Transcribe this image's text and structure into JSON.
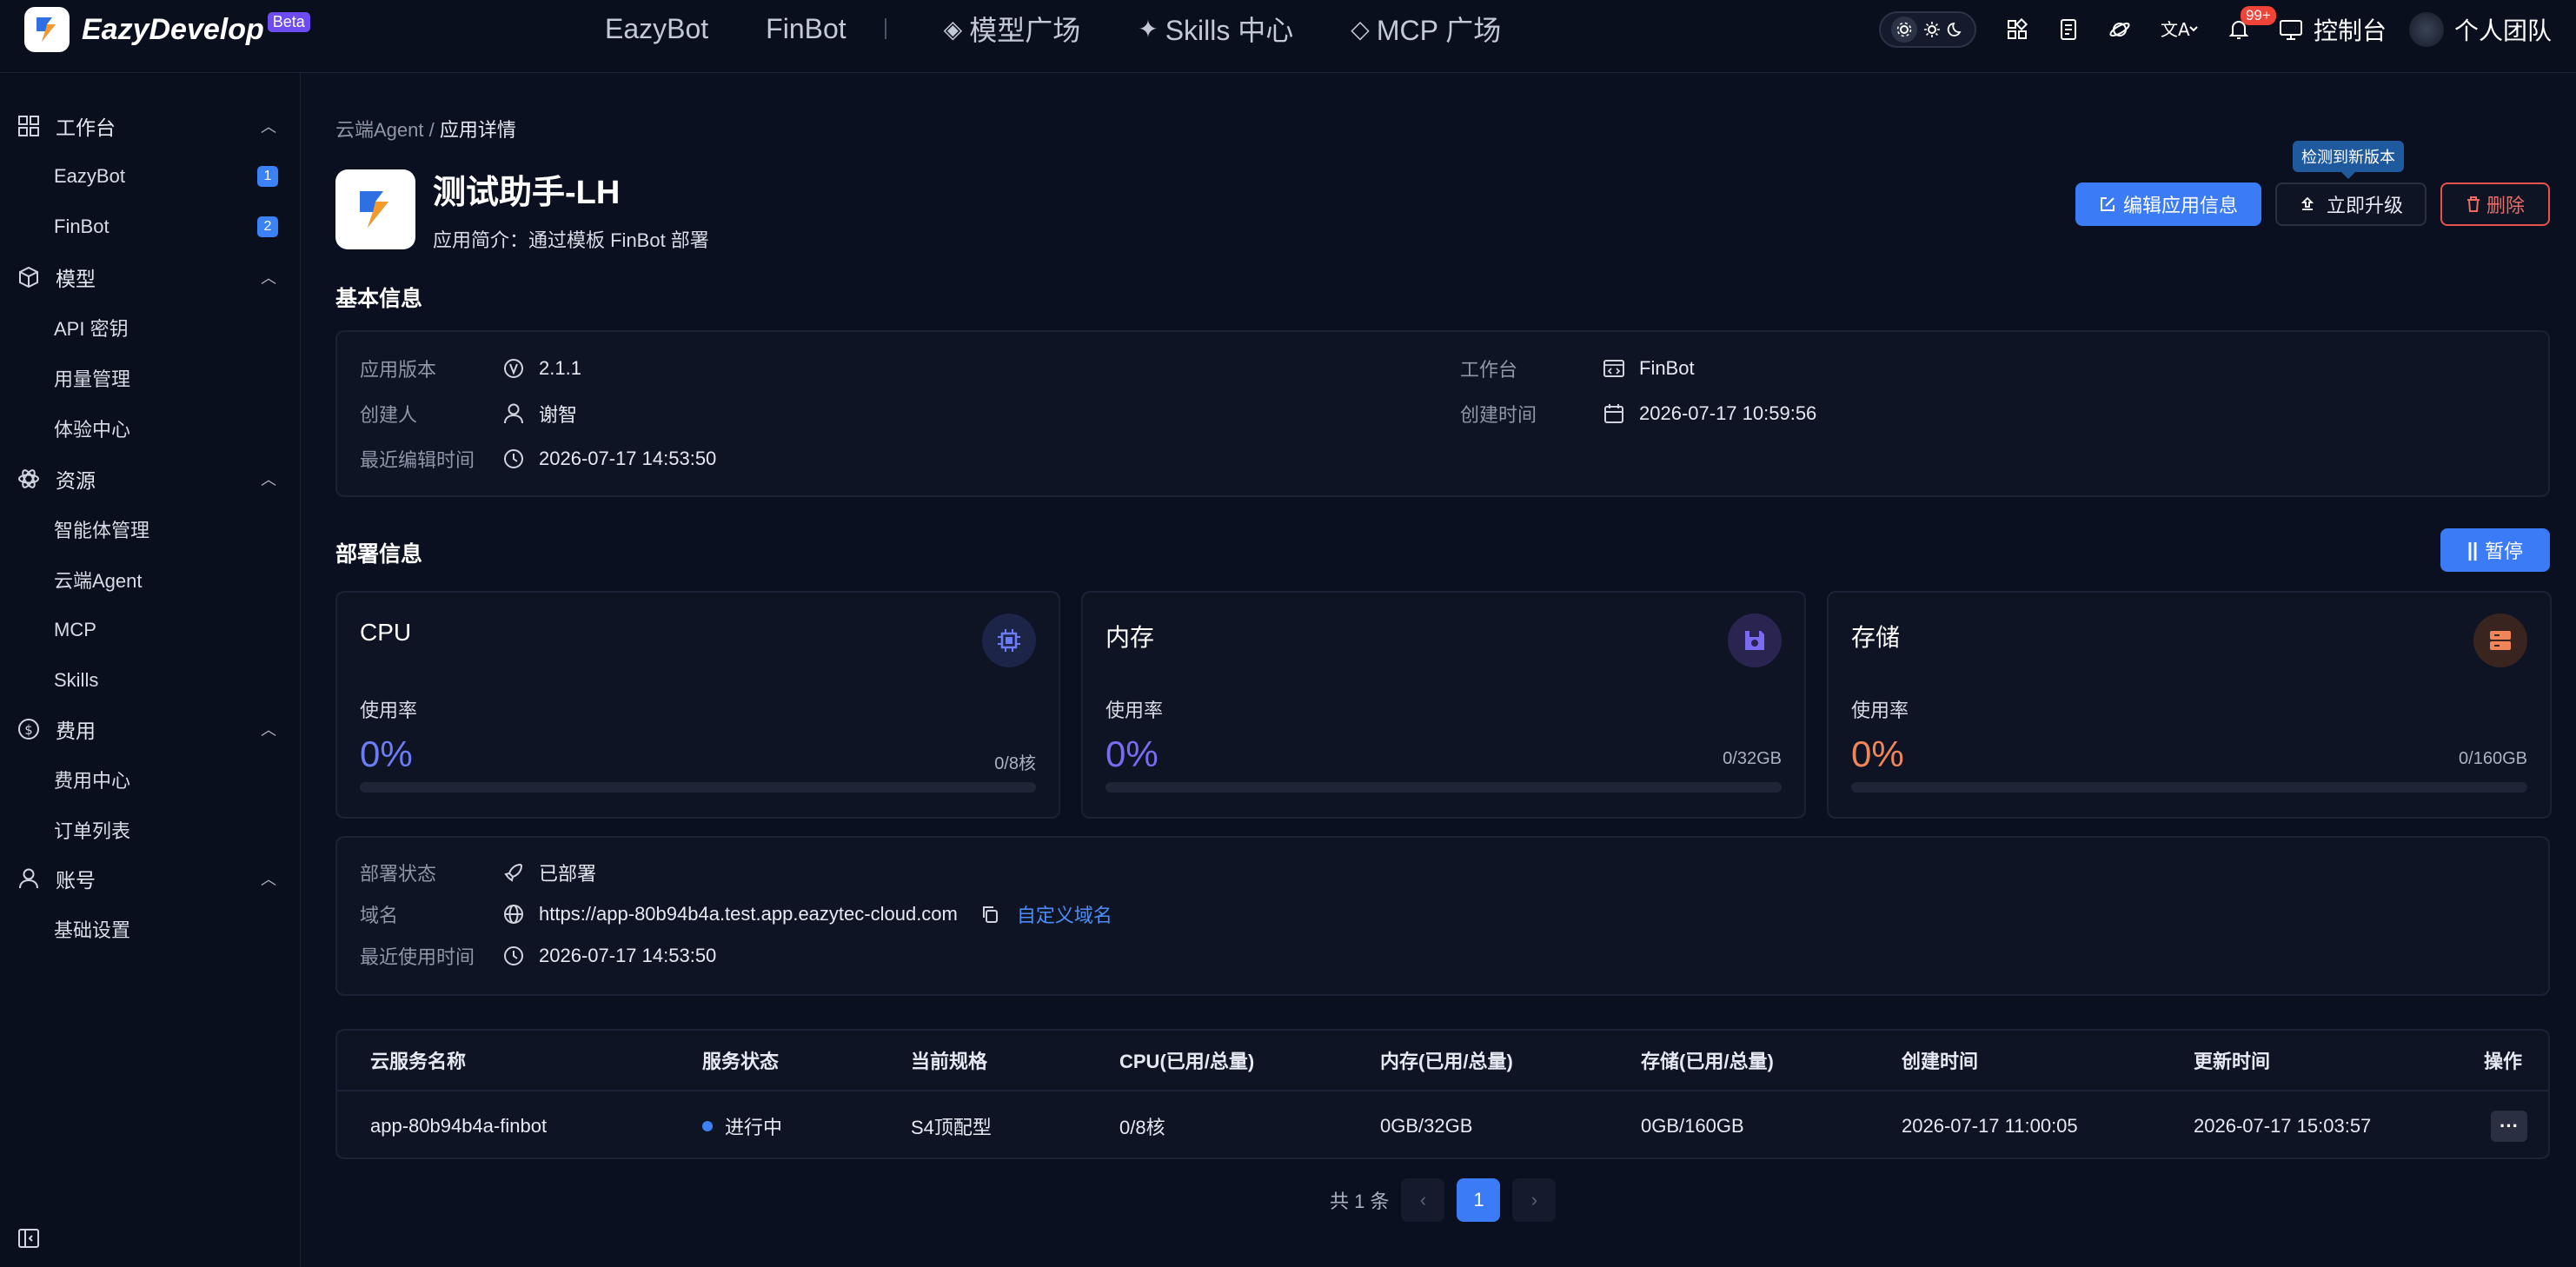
{
  "brand": {
    "name": "EazyDevelop",
    "badge": "Beta"
  },
  "topnav": {
    "items": [
      "EazyBot",
      "FinBot"
    ],
    "items2": [
      {
        "glyph": "◈",
        "label": "模型广场"
      },
      {
        "glyph": "✦",
        "label": "Skills 中心"
      },
      {
        "glyph": "◇",
        "label": "MCP 广场"
      }
    ]
  },
  "tools": {
    "notifications": "99+",
    "console": "控制台",
    "team": "个人团队"
  },
  "sidebar": {
    "groups": [
      {
        "label": "工作台",
        "icon": "grid-icon",
        "items": [
          {
            "label": "EazyBot",
            "count": "1"
          },
          {
            "label": "FinBot",
            "count": "2"
          }
        ]
      },
      {
        "label": "模型",
        "icon": "cube-icon",
        "items": [
          {
            "label": "API 密钥"
          },
          {
            "label": "用量管理"
          },
          {
            "label": "体验中心"
          }
        ]
      },
      {
        "label": "资源",
        "icon": "atom-icon",
        "items": [
          {
            "label": "智能体管理"
          },
          {
            "label": "云端Agent"
          },
          {
            "label": "MCP"
          },
          {
            "label": "Skills"
          }
        ]
      },
      {
        "label": "费用",
        "icon": "dollar-icon",
        "items": [
          {
            "label": "费用中心"
          },
          {
            "label": "订单列表"
          }
        ]
      },
      {
        "label": "账号",
        "icon": "user-icon",
        "items": [
          {
            "label": "基础设置"
          }
        ]
      }
    ]
  },
  "breadcrumb": {
    "parent": "云端Agent",
    "sep": " / ",
    "current": "应用详情"
  },
  "app": {
    "name": "测试助手-LH",
    "desc": "应用简介：通过模板 FinBot 部署"
  },
  "actions": {
    "edit": "编辑应用信息",
    "upgrade": "立即升级",
    "upgrade_tip": "检测到新版本",
    "delete": "删除",
    "pause": "暂停"
  },
  "basic": {
    "title": "基本信息",
    "version_k": "应用版本",
    "version_v": "2.1.1",
    "creator_k": "创建人",
    "creator_v": "谢智",
    "edited_k": "最近编辑时间",
    "edited_v": "2026-07-17 14:53:50",
    "workspace_k": "工作台",
    "workspace_v": "FinBot",
    "created_k": "创建时间",
    "created_v": "2026-07-17 10:59:56"
  },
  "deploy": {
    "title": "部署信息",
    "metrics": [
      {
        "name": "CPU",
        "label": "使用率",
        "percent": "0%",
        "capacity": "0/8核",
        "usage": 0,
        "color": "#6b7cf6",
        "icon": "cpu-icon"
      },
      {
        "name": "内存",
        "label": "使用率",
        "percent": "0%",
        "capacity": "0/32GB",
        "usage": 0,
        "color": "#7a6cf2",
        "icon": "save-icon"
      },
      {
        "name": "存储",
        "label": "使用率",
        "percent": "0%",
        "capacity": "0/160GB",
        "usage": 0,
        "color": "#f0855a",
        "icon": "storage-icon"
      }
    ],
    "status_k": "部署状态",
    "status_v": "已部署",
    "domain_k": "域名",
    "domain_v": "https://app-80b94b4a.test.app.eazytec-cloud.com",
    "custom_domain": "自定义域名",
    "lastuse_k": "最近使用时间",
    "lastuse_v": "2026-07-17 14:53:50"
  },
  "table": {
    "headers": [
      "云服务名称",
      "服务状态",
      "当前规格",
      "CPU(已用/总量)",
      "内存(已用/总量)",
      "存储(已用/总量)",
      "创建时间",
      "更新时间",
      "操作"
    ],
    "rows": [
      [
        "app-80b94b4a-finbot",
        "进行中",
        "S4顶配型",
        "0/8核",
        "0GB/32GB",
        "0GB/160GB",
        "2026-07-17 11:00:05",
        "2026-07-17 15:03:57",
        "···"
      ]
    ]
  },
  "pagination": {
    "total": "共 1 条",
    "page": "1",
    "prev": "‹",
    "next": "›"
  }
}
